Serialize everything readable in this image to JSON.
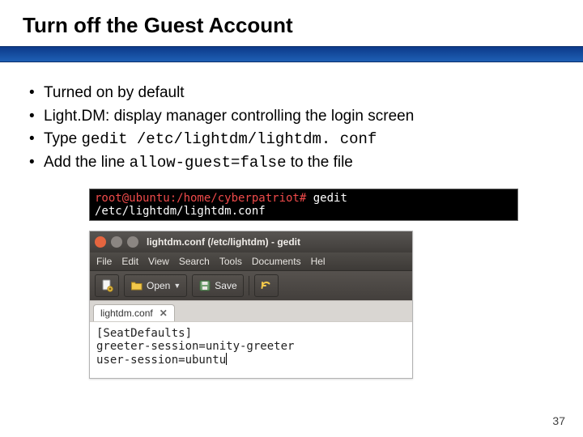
{
  "title": "Turn off the Guest Account",
  "bullets": {
    "b0": "Turned on by default",
    "b1": "Light.DM: display manager controlling the login screen",
    "b2_pre": "Type ",
    "b2_code": "gedit /etc/lightdm/lightdm. conf",
    "b3_pre": "Add the line ",
    "b3_code": "allow-guest=false",
    "b3_post": " to the file"
  },
  "terminal": {
    "prompt": "root@ubuntu:/home/cyberpatriot#",
    "cmd": " gedit /etc/lightdm/lightdm.conf"
  },
  "gedit": {
    "title": "lightdm.conf (/etc/lightdm) - gedit",
    "menu": {
      "file": "File",
      "edit": "Edit",
      "view": "View",
      "search": "Search",
      "tools": "Tools",
      "documents": "Documents",
      "help": "Hel"
    },
    "toolbar": {
      "open": "Open",
      "save": "Save"
    },
    "tab": "lightdm.conf",
    "lines": {
      "l0": "[SeatDefaults]",
      "l1": "greeter-session=unity-greeter",
      "l2": "user-session=ubuntu"
    }
  },
  "page_number": "37"
}
